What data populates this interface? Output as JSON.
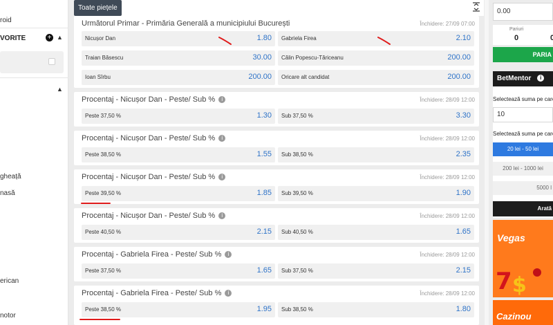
{
  "sidebar": {
    "item_top": "roid",
    "favorites_title": "VORITE",
    "items": [
      "gheață",
      "nasă",
      "erican",
      "notor"
    ]
  },
  "toolbar": {
    "all_markets": "Toate piețele"
  },
  "markets": [
    {
      "title": "Următorul Primar - Primăria Generală a municipiului București",
      "close": "Închidere: 27/09 07:00",
      "rows": [
        [
          {
            "name": "Nicușor Dan",
            "price": "1.80"
          },
          {
            "name": "Gabriela Firea",
            "price": "2.10"
          }
        ],
        [
          {
            "name": "Traian Băsescu",
            "price": "30.00"
          },
          {
            "name": "Călin Popescu-Tăriceanu",
            "price": "200.00"
          }
        ],
        [
          {
            "name": "Ioan Sîrbu",
            "price": "200.00"
          },
          {
            "name": "Oricare alt candidat",
            "price": "200.00"
          }
        ]
      ]
    },
    {
      "title": "Procentaj - Nicușor Dan - Peste/ Sub %",
      "close": "Închidere: 28/09 12:00",
      "over": {
        "name": "Peste 37,50 %",
        "price": "1.30"
      },
      "under": {
        "name": "Sub 37,50 %",
        "price": "3.30"
      }
    },
    {
      "title": "Procentaj - Nicușor Dan - Peste/ Sub %",
      "close": "Închidere: 28/09 12:00",
      "over": {
        "name": "Peste 38,50 %",
        "price": "1.55"
      },
      "under": {
        "name": "Sub 38,50 %",
        "price": "2.35"
      }
    },
    {
      "title": "Procentaj - Nicușor Dan - Peste/ Sub %",
      "close": "Închidere: 28/09 12:00",
      "over": {
        "name": "Peste 39,50 %",
        "price": "1.85"
      },
      "under": {
        "name": "Sub 39,50 %",
        "price": "1.90"
      }
    },
    {
      "title": "Procentaj - Nicușor Dan - Peste/ Sub %",
      "close": "Închidere: 28/09 12:00",
      "over": {
        "name": "Peste 40,50 %",
        "price": "2.15"
      },
      "under": {
        "name": "Sub 40,50 %",
        "price": "1.65"
      }
    },
    {
      "title": "Procentaj - Gabriela Firea - Peste/ Sub %",
      "close": "Închidere: 28/09 12:00",
      "over": {
        "name": "Peste 37,50 %",
        "price": "1.65"
      },
      "under": {
        "name": "Sub 37,50 %",
        "price": "2.15"
      }
    },
    {
      "title": "Procentaj - Gabriela Firea - Peste/ Sub %",
      "close": "Închidere: 28/09 12:00",
      "over": {
        "name": "Peste 38,50 %",
        "price": "1.95"
      },
      "under": {
        "name": "Sub 38,50 %",
        "price": "1.80"
      }
    }
  ],
  "betslip": {
    "amount_value": "0.00",
    "counter_label": "Pariuri",
    "count_left": "0",
    "count_right": "0",
    "place_label": "PARIA"
  },
  "betmentor": {
    "title": "BetMentor",
    "select_amount_label": "Selectează suma pe care",
    "amount_value": "10",
    "select_range_label": "Selectează suma pe care",
    "ranges": [
      "20 lei - 50 lei",
      "200 lei - 1000 lei",
      "5000 l"
    ],
    "show_label": "Arată"
  },
  "ads": [
    "Vegas",
    "Cazinou"
  ],
  "colors": {
    "price_blue": "#2e73c8",
    "active_blue": "#2e7ae0",
    "green": "#1ca64a",
    "dark": "#1c1c1c",
    "orange": "#ff7a1c",
    "annotation_red": "#e01b1b"
  }
}
